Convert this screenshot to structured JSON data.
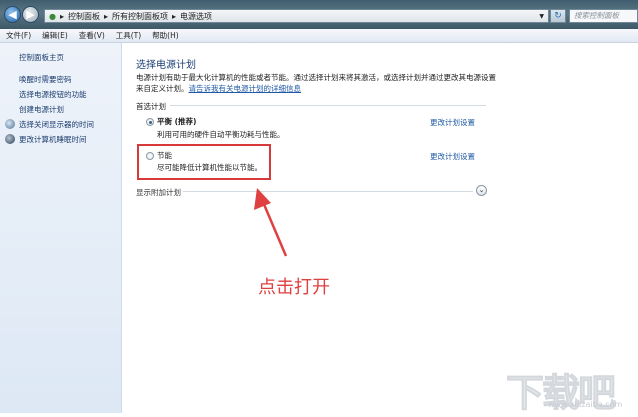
{
  "address": {
    "crumbs": [
      "控制面板",
      "所有控制面板项",
      "电源选项"
    ],
    "search_placeholder": "搜索控制面板"
  },
  "menu": [
    "文件(F)",
    "编辑(E)",
    "查看(V)",
    "工具(T)",
    "帮助(H)"
  ],
  "sidebar": {
    "home": "控制面板主页",
    "items": [
      "唤醒时需要密码",
      "选择电源按钮的功能",
      "创建电源计划",
      "选择关闭显示器的时间",
      "更改计算机睡眠时间"
    ]
  },
  "main": {
    "title": "选择电源计划",
    "desc1": "电源计划有助于最大化计算机的性能或者节能。通过选择计划来将其激活，或选择计划并通过更改其电源设置",
    "desc2": "来自定义计划。",
    "desc_link": "请告诉我有关电源计划的详细信息",
    "preferred_label": "首选计划",
    "plans": [
      {
        "name": "平衡 (推荐)",
        "desc": "利用可用的硬件自动平衡功耗与性能。",
        "link": "更改计划设置",
        "selected": true
      },
      {
        "name": "节能",
        "desc": "尽可能降低计算机性能以节能。",
        "link": "更改计划设置",
        "selected": false
      }
    ],
    "show_more": "显示附加计划"
  },
  "annotation": {
    "text": "点击打开",
    "color": "#e04040"
  },
  "watermark": {
    "logo": "下载吧",
    "url": "www.xiazaiba.com"
  }
}
